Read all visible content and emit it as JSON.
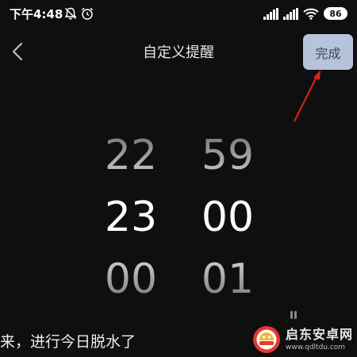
{
  "status_bar": {
    "time": "下午4:48",
    "battery": "86",
    "icons": [
      "bell-off-icon",
      "alarm-clock-icon",
      "signal-icon",
      "signal-icon",
      "wifi-icon",
      "battery-icon"
    ]
  },
  "header": {
    "title": "自定义提醒",
    "back_icon": "chevron-left-icon",
    "done_label": "完成"
  },
  "time_picker": {
    "hours": {
      "above": "22",
      "selected": "23",
      "below": "00"
    },
    "minutes": {
      "above": "59",
      "selected": "00",
      "below": "01"
    }
  },
  "message": "来，进行今日脱水了",
  "watermark": {
    "name": "启东安卓网",
    "url": "www.qdltdu.com"
  },
  "colors": {
    "background": "#0f0f10",
    "done_button_bg": "#b7c3da",
    "annotation_arrow": "#e02020",
    "logo_red": "#e23b30",
    "logo_yellow": "#f2b632"
  }
}
